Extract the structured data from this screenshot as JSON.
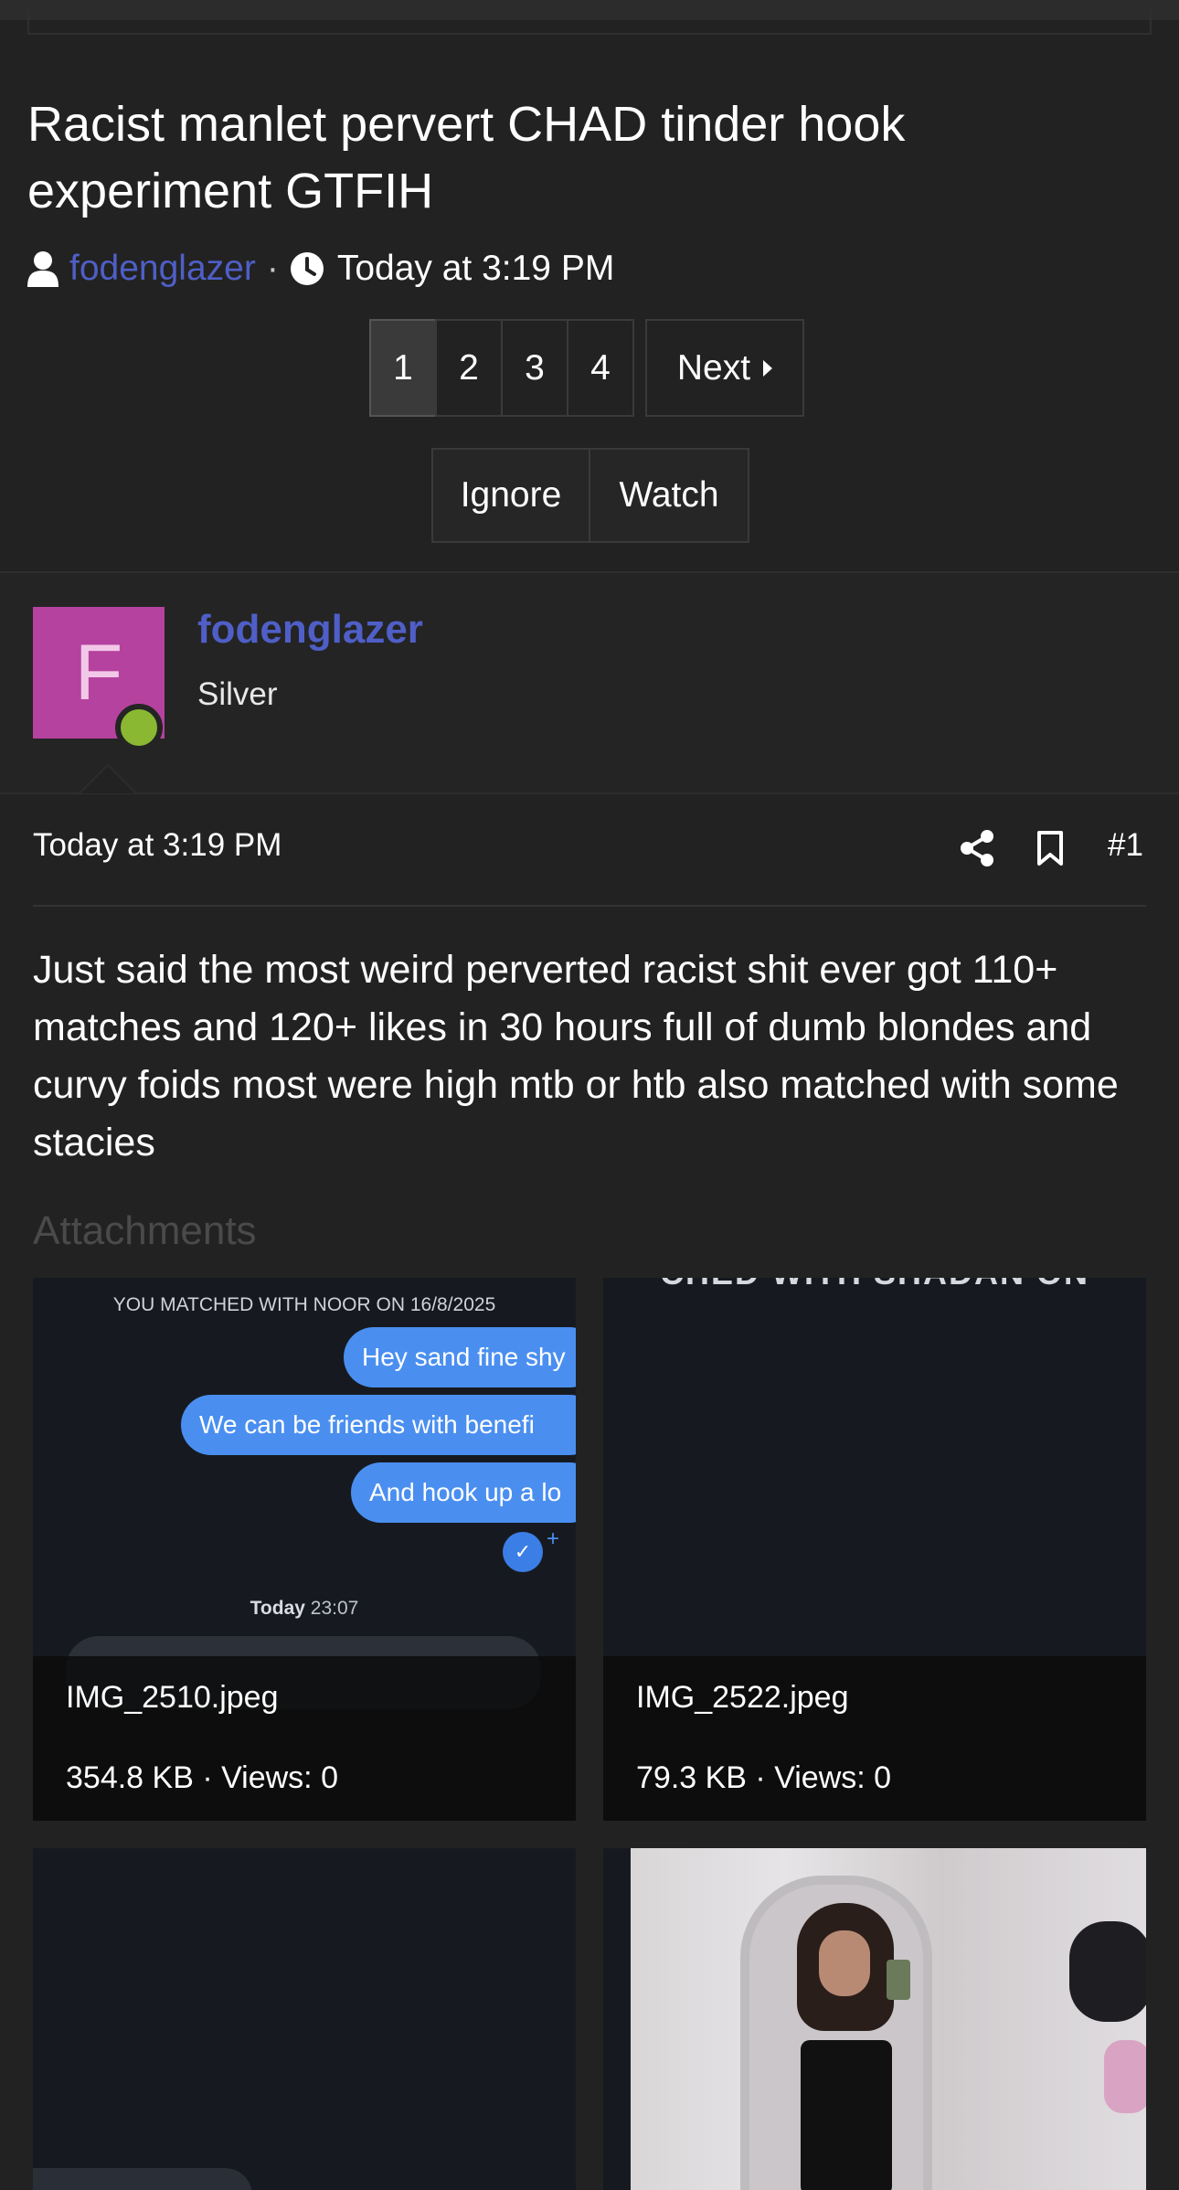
{
  "thread": {
    "title": "Racist manlet pervert CHAD tinder hook experiment GTFIH",
    "author": "fodenglazer",
    "separator": "·",
    "time": "Today at 3:19 PM"
  },
  "pagination": {
    "pages": [
      "1",
      "2",
      "3",
      "4"
    ],
    "current": "1",
    "next_label": "Next"
  },
  "actions": {
    "ignore_label": "Ignore",
    "watch_label": "Watch"
  },
  "post": {
    "avatar_letter": "F",
    "avatar_color": "#b5429e",
    "online_color": "#8ab832",
    "username": "fodenglazer",
    "user_title": "Silver",
    "date": "Today at 3:19 PM",
    "number": "#1",
    "body": "Just said the most weird perverted racist shit ever got 110+ matches and 120+ likes in 30 hours full of dumb blondes and curvy foids most were high mtb or htb also matched with some stacies",
    "attachments_heading": "Attachments"
  },
  "attachments": [
    {
      "filename": "IMG_2510.jpeg",
      "info": "354.8 KB · Views: 0",
      "preview": {
        "match_text": "YOU MATCHED WITH NOOR ON 16/8/2025",
        "bubbles": [
          "Hey sand fine shy",
          "We can be friends with benefi",
          "And hook up a lo"
        ],
        "stamp_bold": "Today",
        "stamp_time": "23:07"
      }
    },
    {
      "filename": "IMG_2522.jpeg",
      "info": "79.3 KB · Views: 0",
      "preview": {
        "cut_text": "CHED WITH SHADAN ON"
      }
    },
    {
      "filename": "",
      "info": ""
    },
    {
      "filename": "",
      "info": ""
    }
  ],
  "colors": {
    "background": "#222222",
    "link": "#4f5fc7",
    "bubble": "#4a8ff0"
  }
}
